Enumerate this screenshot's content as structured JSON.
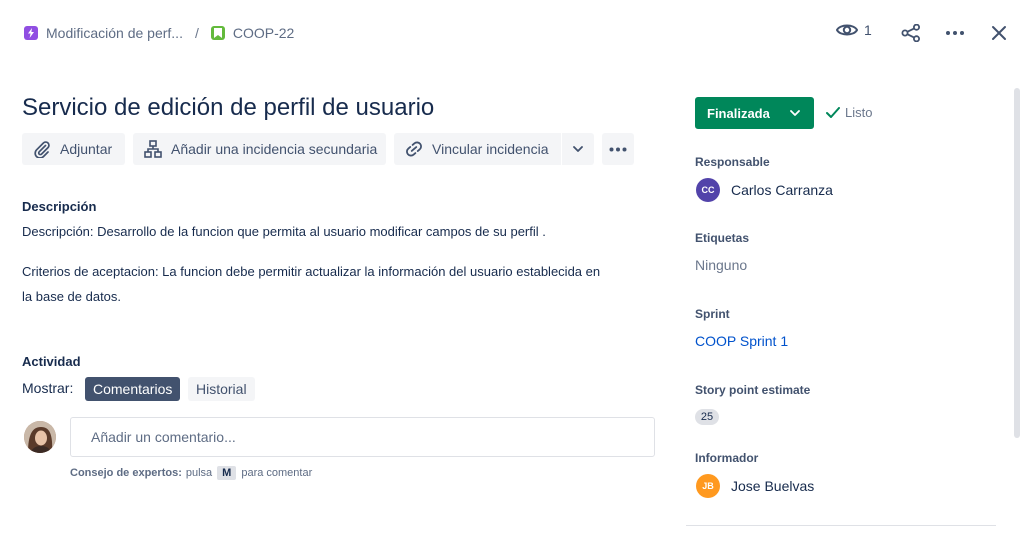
{
  "breadcrumb": {
    "epic": "Modificación de perf...",
    "separator": "/",
    "issue_key": "COOP-22"
  },
  "header": {
    "watchers_count": "1"
  },
  "issue": {
    "title": "Servicio de edición de perfil de usuario"
  },
  "toolbar": {
    "attach_label": "Adjuntar",
    "child_issue_label": "Añadir una incidencia secundaria",
    "link_issue_label": "Vincular incidencia"
  },
  "description": {
    "heading": "Descripción",
    "line1": "Descripción: Desarrollo de la funcion que permita al usuario modificar campos de  su perfil .",
    "line2": "Criterios de aceptacion: La funcion debe permitir actualizar la información del usuario establecida en",
    "line3": "la base de datos."
  },
  "activity": {
    "heading": "Actividad",
    "show_label": "Mostrar:",
    "tab_comments": "Comentarios",
    "tab_history": "Historial",
    "comment_placeholder": "Añadir un comentario...",
    "tip_bold": "Consejo de expertos:",
    "tip_pre": "pulsa",
    "tip_key": "M",
    "tip_post": "para comentar"
  },
  "status": {
    "label": "Finalizada",
    "resolution": "Listo"
  },
  "fields": {
    "assignee_label": "Responsable",
    "assignee_initials": "CC",
    "assignee_name": "Carlos Carranza",
    "labels_label": "Etiquetas",
    "labels_value": "Ninguno",
    "sprint_label": "Sprint",
    "sprint_value": "COOP Sprint 1",
    "story_points_label": "Story point estimate",
    "story_points_value": "25",
    "reporter_label": "Informador",
    "reporter_initials": "JB",
    "reporter_name": "Jose Buelvas"
  },
  "colors": {
    "status_green": "#00875a",
    "link_blue": "#0052cc",
    "epic_purple": "#904ee2",
    "story_green": "#63ba3c",
    "assignee_avatar": "#5243aa",
    "reporter_avatar": "#ff991f"
  }
}
